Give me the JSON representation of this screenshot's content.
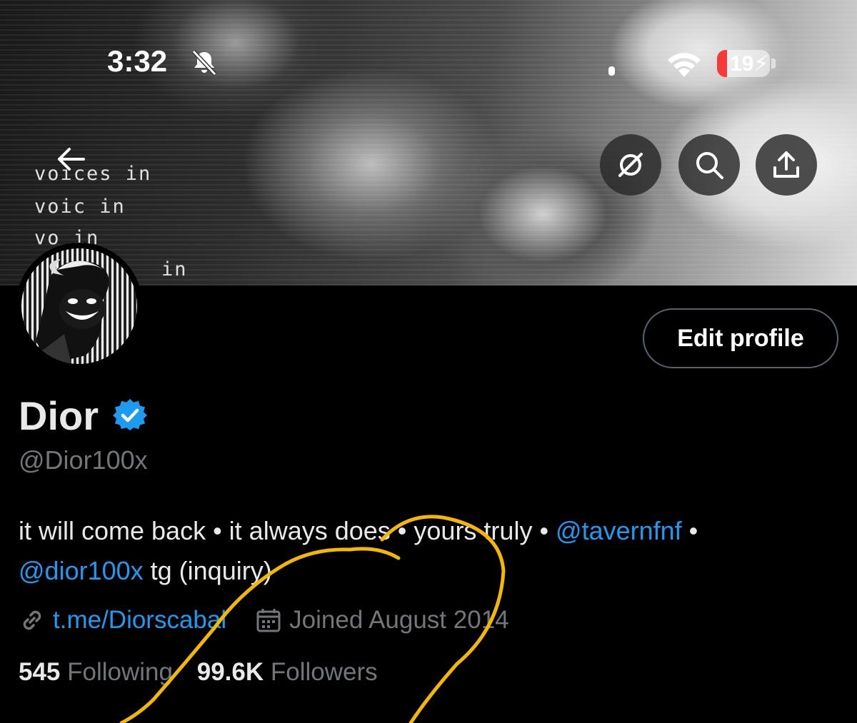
{
  "status_bar": {
    "time": "3:32",
    "battery": "19"
  },
  "banner": {
    "lines": [
      "voices in",
      "voic in",
      "vo in",
      "in"
    ]
  },
  "profile": {
    "name": "Dior",
    "handle": "@Dior100x",
    "edit_button": "Edit profile",
    "bio": {
      "part1": "it will come back • it always does • yours truly • ",
      "mention1": "@tavernfnf",
      "part2": " •",
      "mention2": "@dior100x",
      "part3": " tg (inquiry)"
    },
    "link": "t.me/Diorscabal",
    "joined": "Joined August 2014",
    "following_count": "545",
    "following_label": "Following",
    "followers_count": "99.6K",
    "followers_label": "Followers"
  },
  "icons": {
    "back": "back-arrow-icon",
    "grok": "grok-icon",
    "search": "search-icon",
    "share": "share-icon",
    "verified": "verified-badge-icon",
    "link": "link-icon",
    "calendar": "calendar-icon"
  },
  "colors": {
    "accent": "#1d9bf0",
    "secondary_text": "#71767b",
    "annotation": "#f5b800"
  }
}
